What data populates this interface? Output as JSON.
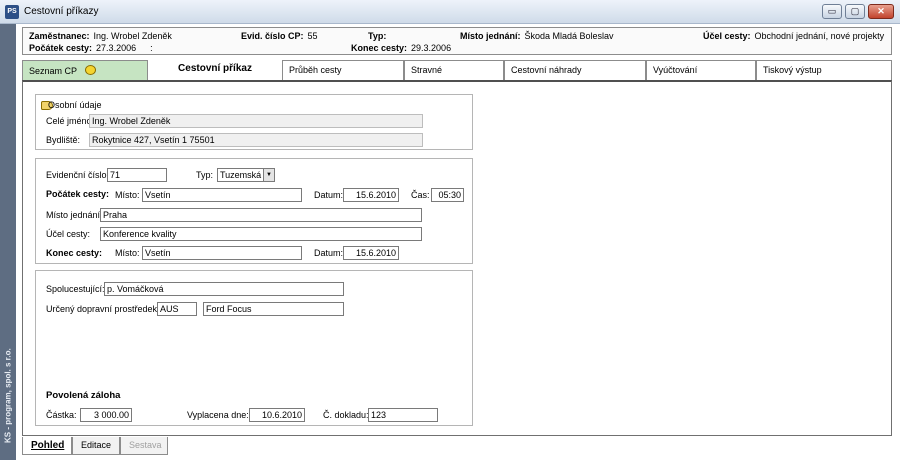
{
  "window": {
    "title": "Cestovní příkazy",
    "icon_text": "PS",
    "min_label": "▭",
    "max_label": "▢",
    "close_label": "✕"
  },
  "sidebar_text": "KS - program, spol. s r.o.",
  "summary": {
    "zamestnanec_label": "Zaměstnanec:",
    "zamestnanec": "Ing. Wrobel Zdeněk",
    "evid_label": "Evid. číslo CP:",
    "evid": "55",
    "typ_label": "Typ:",
    "typ": "",
    "misto_label": "Místo jednání:",
    "misto": "Škoda Mladá Boleslav",
    "ucel_label": "Účel cesty:",
    "ucel": "Obchodní jednání, nové projekty",
    "pocatek_label": "Počátek cesty:",
    "pocatek": "27.3.2006",
    "pocatek_sep": ":",
    "konec_label": "Konec cesty:",
    "konec": "29.3.2006"
  },
  "tabs": [
    "Seznam CP",
    "Cestovní příkaz",
    "Průběh cesty",
    "Stravné",
    "Cestovní náhrady",
    "Vyúčtování",
    "Tiskový výstup"
  ],
  "osobni": {
    "legend": "Osobní údaje",
    "jmeno_label": "Celé jméno:",
    "jmeno": "Ing. Wrobel Zdeněk",
    "bydliste_label": "Bydliště:",
    "bydliste": "Rokytnice 427, Vsetín 1  75501"
  },
  "cesta": {
    "evid_label": "Evidenční číslo:",
    "evid": "71",
    "typ_label": "Typ:",
    "typ": "Tuzemská",
    "pocatek_label": "Počátek cesty:",
    "misto_label": "Místo:",
    "pocatek_misto": "Vsetín",
    "datum_label": "Datum:",
    "pocatek_datum": "15.6.2010",
    "cas_label": "Čas:",
    "pocatek_cas": "05:30",
    "jednani_label": "Místo jednání:",
    "jednani": "Praha",
    "ucel_label": "Účel cesty:",
    "ucel": "Konference kvality",
    "konec_label": "Konec cesty:",
    "konec_misto": "Vsetín",
    "konec_datum": "15.6.2010"
  },
  "dalsi": {
    "spolu_label": "Spolucestující:",
    "spolu": "p. Vomáčková",
    "doprava_label": "Určený dopravní prostředek:",
    "doprava_kod": "AUS",
    "doprava": "Ford Focus",
    "zaloha_title": "Povolená záloha",
    "castka_label": "Částka:",
    "castka": "3 000.00",
    "vyplacena_label": "Vyplacena dne:",
    "vyplacena": "10.6.2010",
    "doklad_label": "Č. dokladu:",
    "doklad": "123"
  },
  "bottom_tabs": [
    "Pohled",
    "Editace",
    "Sestava"
  ]
}
